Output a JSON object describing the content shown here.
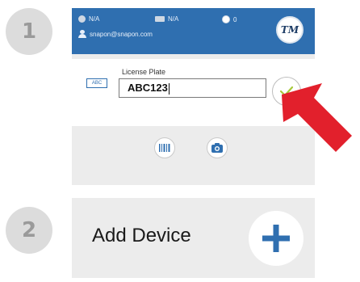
{
  "steps": [
    {
      "number": "1"
    },
    {
      "number": "2"
    }
  ],
  "status_bar": {
    "item1": "N/A",
    "item2": "N/A",
    "item3": "0",
    "user_email": "snapon@snapon.com",
    "logo_text": "TM"
  },
  "form": {
    "plate_icon_text": "ABC",
    "label": "License Plate",
    "value": "ABC123"
  },
  "add_device": {
    "label": "Add Device"
  },
  "colors": {
    "brand_blue": "#2f6fb0",
    "check_green": "#a7c93a",
    "arrow_red": "#e2202c"
  },
  "icons": [
    "barcode-scan-icon",
    "camera-icon",
    "check-icon",
    "plus-icon",
    "pointer-arrow-icon"
  ]
}
